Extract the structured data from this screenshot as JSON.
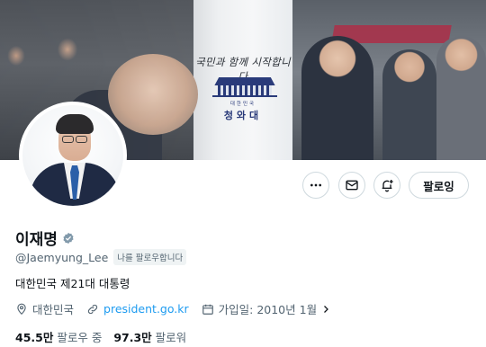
{
  "banner": {
    "slogan": "국민과 함께 시작합니다",
    "org_small": "대한민국",
    "org_name": "청와대"
  },
  "header": {
    "follow_label": "팔로잉"
  },
  "profile": {
    "name": "이재명",
    "handle": "@Jaemyung_Lee",
    "follows_you": "나를 팔로우합니다",
    "bio": "대한민국 제21대 대통령",
    "location": "대한민국",
    "website": "president.go.kr",
    "joined": "가입일: 2010년 1월"
  },
  "stats": {
    "following_count": "45.5만",
    "following_label": "팔로우 중",
    "followers_count": "97.3만",
    "followers_label": "팔로워"
  },
  "colors": {
    "accent": "#1d9bf0",
    "verified_badge": "#829aab",
    "text_secondary": "#536471"
  },
  "icons": [
    "more-icon",
    "mail-icon",
    "notification-plus-icon",
    "verified-icon",
    "location-icon",
    "link-icon",
    "calendar-icon",
    "chevron-right-icon"
  ]
}
